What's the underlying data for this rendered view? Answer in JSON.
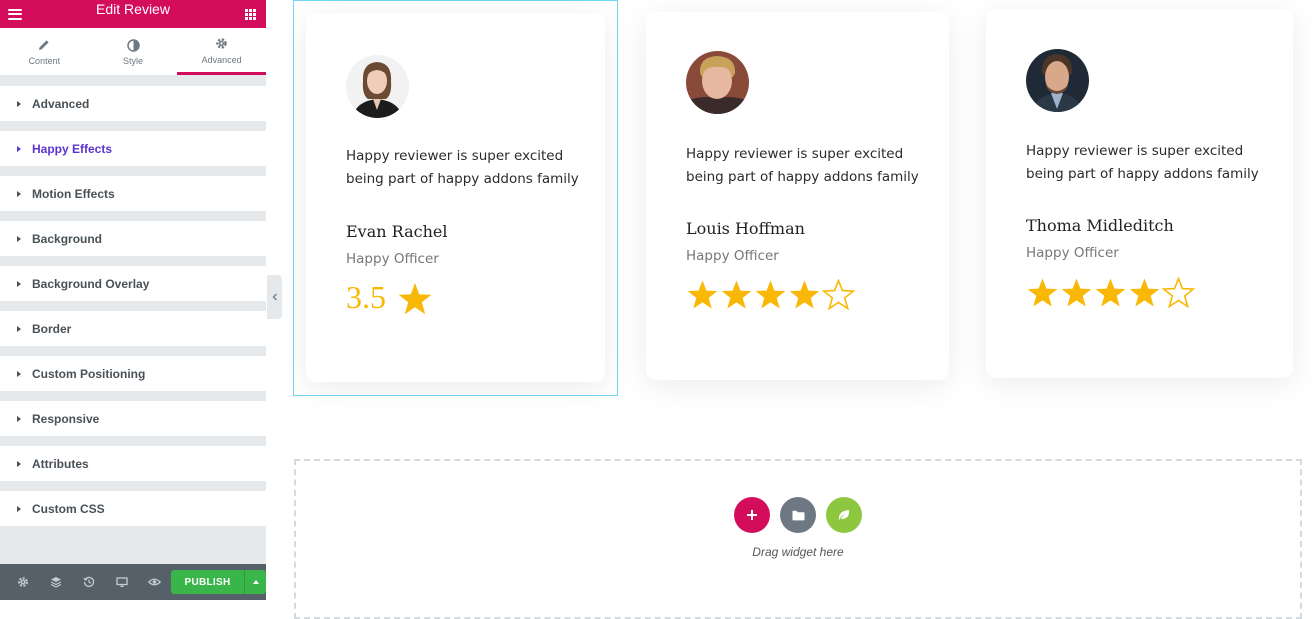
{
  "editor": {
    "header": {
      "title": "Edit Review"
    },
    "tabs": [
      {
        "label": "Content",
        "icon": "pencil-icon"
      },
      {
        "label": "Style",
        "icon": "contrast-icon"
      },
      {
        "label": "Advanced",
        "icon": "gear-icon",
        "active": true
      }
    ],
    "sections": [
      "Advanced",
      "Happy Effects",
      "Motion Effects",
      "Background",
      "Background Overlay",
      "Border",
      "Custom Positioning",
      "Responsive",
      "Attributes",
      "Custom CSS"
    ],
    "footer": {
      "publish_label": "PUBLISH"
    }
  },
  "reviews": [
    {
      "text_line1": "Happy reviewer is super excited",
      "text_line2": "being part of happy addons family",
      "name": "Evan Rachel",
      "title": "Happy Officer",
      "rating_display": "3.5",
      "rating": 3.5,
      "rating_style": "number"
    },
    {
      "text_line1": "Happy reviewer is super excited",
      "text_line2": "being part of happy addons family",
      "name": "Louis Hoffman",
      "title": "Happy Officer",
      "rating": 4,
      "rating_style": "stars"
    },
    {
      "text_line1": "Happy reviewer is super excited",
      "text_line2": "being part of happy addons family",
      "name": "Thoma Midleditch",
      "title": "Happy Officer",
      "rating": 4,
      "rating_style": "stars"
    }
  ],
  "dropzone": {
    "text": "Drag widget here"
  },
  "colors": {
    "brand": "#d30c5c",
    "accent_purple": "#5b34d0",
    "star": "#f8b805",
    "publish": "#39b54a",
    "footer": "#556068"
  }
}
